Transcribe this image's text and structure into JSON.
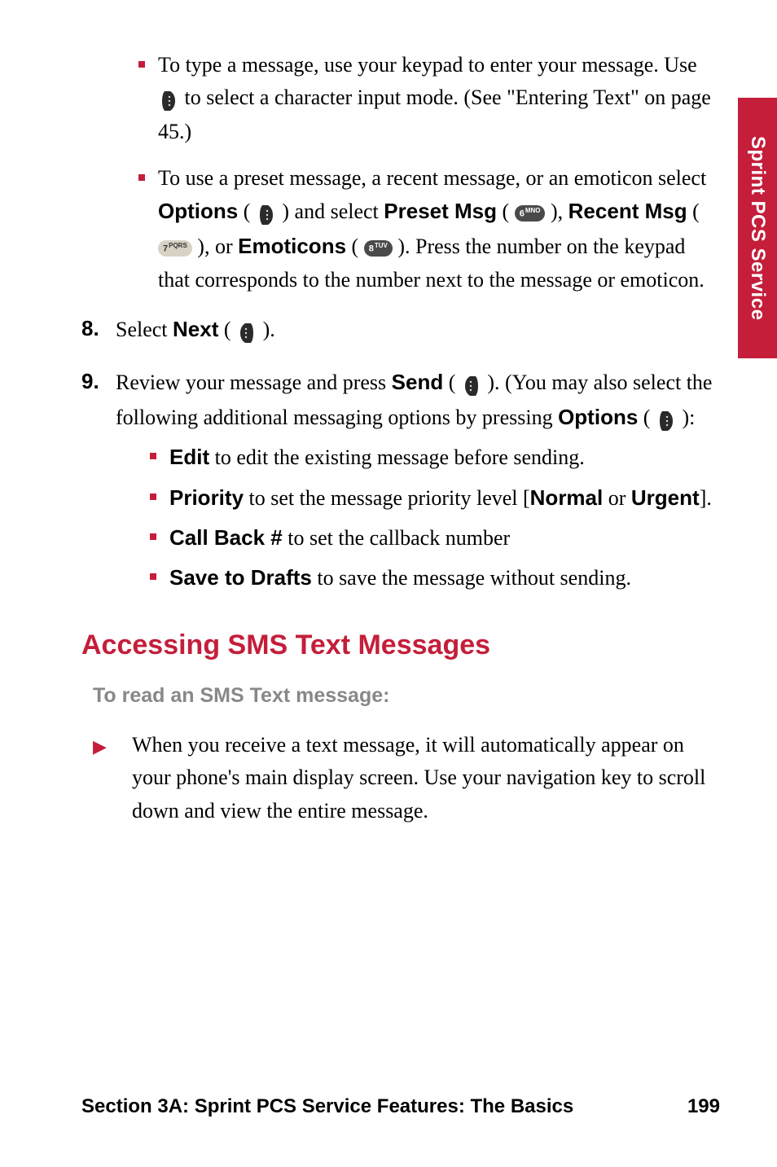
{
  "sideTab": "Sprint PCS Service",
  "bullets_top": {
    "b1_part1": "To type a message, use your keypad to enter your message. Use ",
    "b1_part2": " to select a character input mode. (See \"Entering Text\" on page 45.)",
    "b2_part1": "To use a preset message, a recent message, or an emoticon select ",
    "options": "Options",
    "b2_part2": " (",
    "b2_part3": ") and select ",
    "presetMsg": "Preset Msg",
    "b2_part4": " (",
    "b2_part5": "), ",
    "recentMsg": "Recent Msg",
    "b2_part6": " (",
    "b2_part7": "), or ",
    "emoticons": "Emoticons",
    "b2_part8": " (",
    "b2_part9": "). Press the number on the keypad that corresponds to the number next to the message or emoticon."
  },
  "step8": {
    "num": "8.",
    "text1": "Select ",
    "next": "Next",
    "text2": " (",
    "text3": ")."
  },
  "step9": {
    "num": "9.",
    "text1": "Review your message and press ",
    "send": "Send",
    "text2": " (",
    "text3": "). (You may also select the following additional messaging options by pressing ",
    "options": "Options",
    "text4": " (",
    "text5": "):",
    "opts": {
      "edit": "Edit",
      "edit_t": " to edit the existing message before sending.",
      "priority": "Priority",
      "priority_t1": " to set the message priority level [",
      "normal": "Normal",
      "or": " or ",
      "urgent": "Urgent",
      "priority_t2": "].",
      "callback": "Call Back #",
      "callback_t": " to set the callback number",
      "save": "Save to Drafts",
      "save_t": " to save the message without sending."
    }
  },
  "heading": "Accessing SMS Text Messages",
  "subhead": "To read an SMS Text message:",
  "arrow_text": "When you receive a text message, it will automatically appear on your phone's main display screen. Use your navigation key to scroll down and view the entire message.",
  "footer": {
    "section": "Section 3A: Sprint PCS Service Features: The Basics",
    "page": "199"
  },
  "keys": {
    "k6": "6",
    "k6s": "MNO",
    "k7": "7",
    "k7s": "PQRS",
    "k8": "8",
    "k8s": "TUV"
  }
}
